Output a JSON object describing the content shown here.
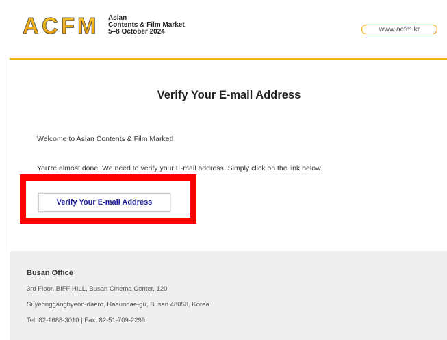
{
  "header": {
    "logo_text": "ACFM",
    "logo_letters": [
      "A",
      "C",
      "F",
      "M"
    ],
    "tagline_line1": "Asian",
    "tagline_line2": "Contents & Film Market",
    "tagline_line3": "5–8 October 2024",
    "site_link": "www.acfm.kr"
  },
  "colors": {
    "accent": "#f3b11c",
    "logo_gold": "#f2a900",
    "highlight_red": "#ff0000",
    "button_text": "#1a1a9a",
    "footer_bg": "#efefef"
  },
  "main": {
    "title": "Verify Your E-mail Address",
    "welcome": "Welcome to Asian Contents & Film Market!",
    "instruction": "You're almost done! We need to verify your E-mail address. Simply click on the link below.",
    "verify_button": "Verify Your E-mail  Address"
  },
  "footer": {
    "office_title": "Busan Office",
    "address_line1": "3rd Floor, BIFF HILL, Busan Cinema Center, 120",
    "address_line2": "Suyeonggangbyeon-daero, Haeundae-gu, Busan 48058, Korea",
    "contact": "Tel. 82-1688-3010 | Fax. 82-51-709-2299"
  }
}
